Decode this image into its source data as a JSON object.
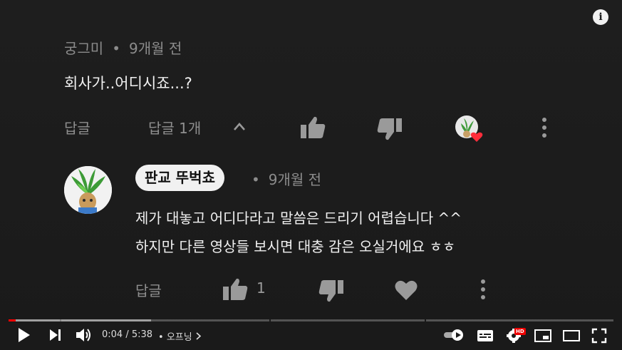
{
  "comment": {
    "author": "궁그미",
    "separator": "•",
    "time": "9개월 전",
    "text": "회사가..어디시죠...?",
    "reply_label": "답글",
    "replies_label": "답글 1개"
  },
  "reply": {
    "author": "판교 뚜벅쵸",
    "separator": "•",
    "time": "9개월 전",
    "line1": "제가 대놓고 어디다라고 말씀은 드리기 어렵습니다 ^^",
    "line2": "하지만 다른 영상들 보시면 대충 감은 오실거에요 ㅎㅎ",
    "reply_label": "답글",
    "like_count": "1"
  },
  "player": {
    "time_display": "0:04 / 5:38",
    "chapter_separator": "•",
    "chapter": "오프닝",
    "progress_fraction": 0.012,
    "buffer_fraction": 0.235,
    "hd_badge": "HD",
    "accent_color": "#ff0000"
  }
}
